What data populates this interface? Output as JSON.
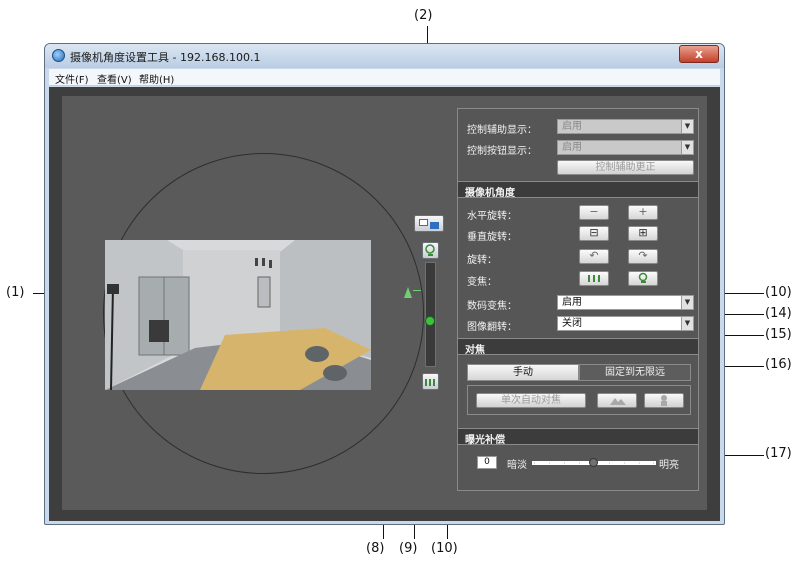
{
  "window": {
    "title": "摄像机角度设置工具 - 192.168.100.1",
    "close_label": "x"
  },
  "menu": [
    {
      "label": "文件(F)"
    },
    {
      "label": "查看(V)"
    },
    {
      "label": "帮助(H)"
    }
  ],
  "callouts": {
    "c1": "(1)",
    "c2": "(2)",
    "c8": "(8)",
    "c9": "(9)",
    "c10a": "(10)",
    "c10b": "(10)",
    "c14": "(14)",
    "c15": "(15)",
    "c16": "(16)",
    "c17": "(17)"
  },
  "panel": {
    "assist_display_label": "控制辅助显示：",
    "assist_display_value": "启用",
    "button_display_label": "控制按钮显示：",
    "button_display_value": "启用",
    "assist_change_button": "控制辅助更正",
    "camera_angle": {
      "title": "摄像机角度",
      "pan_label": "水平旋转：",
      "tilt_label": "垂直旋转：",
      "rotate_label": "旋转：",
      "zoom_label": "变焦：",
      "digital_zoom_label": "数码变焦：",
      "digital_zoom_value": "启用",
      "flip_label": "图像翻转：",
      "flip_value": "关闭"
    },
    "focus": {
      "title": "对焦",
      "manual": "手动",
      "fixed_infinity": "固定到无限远",
      "one_shot_af": "单次自动对焦"
    },
    "exposure": {
      "title": "曝光补偿",
      "value": "0",
      "dark_label": "暗淡",
      "bright_label": "明亮",
      "level": 0.5
    }
  },
  "colors": {
    "client_bg": "#3e3e3e",
    "panel_bg": "#565656",
    "zoom_handle": "#3fbf3f"
  }
}
